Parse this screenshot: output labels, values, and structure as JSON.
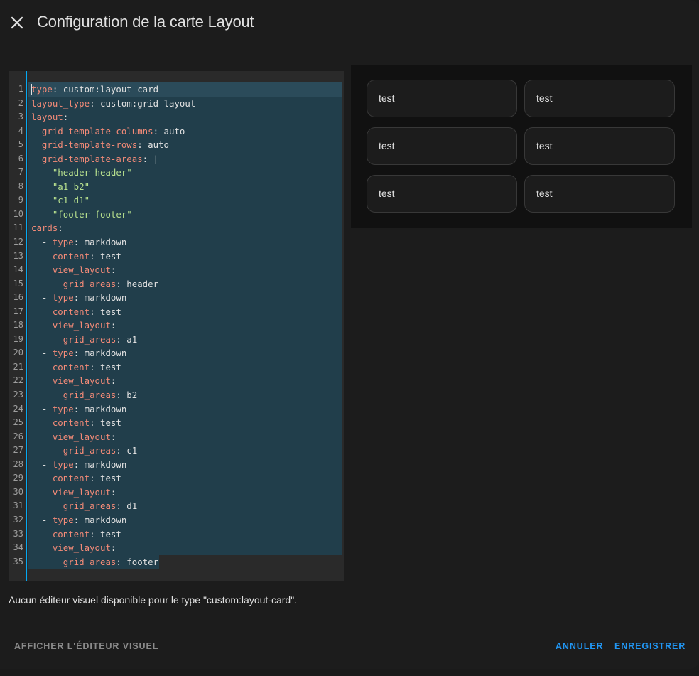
{
  "dialog": {
    "title": "Configuration de la carte Layout"
  },
  "editor": {
    "lines": [
      [
        [
          "k",
          "type"
        ],
        [
          "p",
          ": "
        ],
        [
          "v",
          "custom:layout-card"
        ]
      ],
      [
        [
          "k",
          "layout_type"
        ],
        [
          "p",
          ": "
        ],
        [
          "v",
          "custom:grid-layout"
        ]
      ],
      [
        [
          "k",
          "layout"
        ],
        [
          "p",
          ":"
        ]
      ],
      [
        [
          "i",
          "  "
        ],
        [
          "k",
          "grid-template-columns"
        ],
        [
          "p",
          ": "
        ],
        [
          "v",
          "auto"
        ]
      ],
      [
        [
          "i",
          "  "
        ],
        [
          "k",
          "grid-template-rows"
        ],
        [
          "p",
          ": "
        ],
        [
          "v",
          "auto"
        ]
      ],
      [
        [
          "i",
          "  "
        ],
        [
          "k",
          "grid-template-areas"
        ],
        [
          "p",
          ": "
        ],
        [
          "v",
          "|"
        ]
      ],
      [
        [
          "i",
          "    "
        ],
        [
          "s",
          "\"header header\""
        ]
      ],
      [
        [
          "i",
          "    "
        ],
        [
          "s",
          "\"a1 b2\""
        ]
      ],
      [
        [
          "i",
          "    "
        ],
        [
          "s",
          "\"c1 d1\""
        ]
      ],
      [
        [
          "i",
          "    "
        ],
        [
          "s",
          "\"footer footer\""
        ]
      ],
      [
        [
          "k",
          "cards"
        ],
        [
          "p",
          ":"
        ]
      ],
      [
        [
          "i",
          "  "
        ],
        [
          "p",
          "- "
        ],
        [
          "k",
          "type"
        ],
        [
          "p",
          ": "
        ],
        [
          "v",
          "markdown"
        ]
      ],
      [
        [
          "i",
          "    "
        ],
        [
          "k",
          "content"
        ],
        [
          "p",
          ": "
        ],
        [
          "v",
          "test"
        ]
      ],
      [
        [
          "i",
          "    "
        ],
        [
          "k",
          "view_layout"
        ],
        [
          "p",
          ":"
        ]
      ],
      [
        [
          "i",
          "      "
        ],
        [
          "k",
          "grid_areas"
        ],
        [
          "p",
          ": "
        ],
        [
          "v",
          "header"
        ]
      ],
      [
        [
          "i",
          "  "
        ],
        [
          "p",
          "- "
        ],
        [
          "k",
          "type"
        ],
        [
          "p",
          ": "
        ],
        [
          "v",
          "markdown"
        ]
      ],
      [
        [
          "i",
          "    "
        ],
        [
          "k",
          "content"
        ],
        [
          "p",
          ": "
        ],
        [
          "v",
          "test"
        ]
      ],
      [
        [
          "i",
          "    "
        ],
        [
          "k",
          "view_layout"
        ],
        [
          "p",
          ":"
        ]
      ],
      [
        [
          "i",
          "      "
        ],
        [
          "k",
          "grid_areas"
        ],
        [
          "p",
          ": "
        ],
        [
          "v",
          "a1"
        ]
      ],
      [
        [
          "i",
          "  "
        ],
        [
          "p",
          "- "
        ],
        [
          "k",
          "type"
        ],
        [
          "p",
          ": "
        ],
        [
          "v",
          "markdown"
        ]
      ],
      [
        [
          "i",
          "    "
        ],
        [
          "k",
          "content"
        ],
        [
          "p",
          ": "
        ],
        [
          "v",
          "test"
        ]
      ],
      [
        [
          "i",
          "    "
        ],
        [
          "k",
          "view_layout"
        ],
        [
          "p",
          ":"
        ]
      ],
      [
        [
          "i",
          "      "
        ],
        [
          "k",
          "grid_areas"
        ],
        [
          "p",
          ": "
        ],
        [
          "v",
          "b2"
        ]
      ],
      [
        [
          "i",
          "  "
        ],
        [
          "p",
          "- "
        ],
        [
          "k",
          "type"
        ],
        [
          "p",
          ": "
        ],
        [
          "v",
          "markdown"
        ]
      ],
      [
        [
          "i",
          "    "
        ],
        [
          "k",
          "content"
        ],
        [
          "p",
          ": "
        ],
        [
          "v",
          "test"
        ]
      ],
      [
        [
          "i",
          "    "
        ],
        [
          "k",
          "view_layout"
        ],
        [
          "p",
          ":"
        ]
      ],
      [
        [
          "i",
          "      "
        ],
        [
          "k",
          "grid_areas"
        ],
        [
          "p",
          ": "
        ],
        [
          "v",
          "c1"
        ]
      ],
      [
        [
          "i",
          "  "
        ],
        [
          "p",
          "- "
        ],
        [
          "k",
          "type"
        ],
        [
          "p",
          ": "
        ],
        [
          "v",
          "markdown"
        ]
      ],
      [
        [
          "i",
          "    "
        ],
        [
          "k",
          "content"
        ],
        [
          "p",
          ": "
        ],
        [
          "v",
          "test"
        ]
      ],
      [
        [
          "i",
          "    "
        ],
        [
          "k",
          "view_layout"
        ],
        [
          "p",
          ":"
        ]
      ],
      [
        [
          "i",
          "      "
        ],
        [
          "k",
          "grid_areas"
        ],
        [
          "p",
          ": "
        ],
        [
          "v",
          "d1"
        ]
      ],
      [
        [
          "i",
          "  "
        ],
        [
          "p",
          "- "
        ],
        [
          "k",
          "type"
        ],
        [
          "p",
          ": "
        ],
        [
          "v",
          "markdown"
        ]
      ],
      [
        [
          "i",
          "    "
        ],
        [
          "k",
          "content"
        ],
        [
          "p",
          ": "
        ],
        [
          "v",
          "test"
        ]
      ],
      [
        [
          "i",
          "    "
        ],
        [
          "k",
          "view_layout"
        ],
        [
          "p",
          ":"
        ]
      ],
      [
        [
          "i",
          "      "
        ],
        [
          "k",
          "grid_areas"
        ],
        [
          "p",
          ": "
        ],
        [
          "v",
          "footer"
        ]
      ]
    ]
  },
  "preview": {
    "cards": [
      "test",
      "test",
      "test",
      "test",
      "test",
      "test"
    ]
  },
  "notice": "Aucun éditeur visuel disponible pour le type \"custom:layout-card\".",
  "actions": {
    "show_visual_editor": "Afficher l'éditeur visuel",
    "cancel": "Annuler",
    "save": "Enregistrer"
  },
  "colors": {
    "accent": "#03a9f4",
    "button": "#2196f3",
    "yaml_key": "#f48b78",
    "yaml_string": "#b7e08e",
    "selection": "#213e4b"
  },
  "icons": {
    "close": "close-icon"
  }
}
